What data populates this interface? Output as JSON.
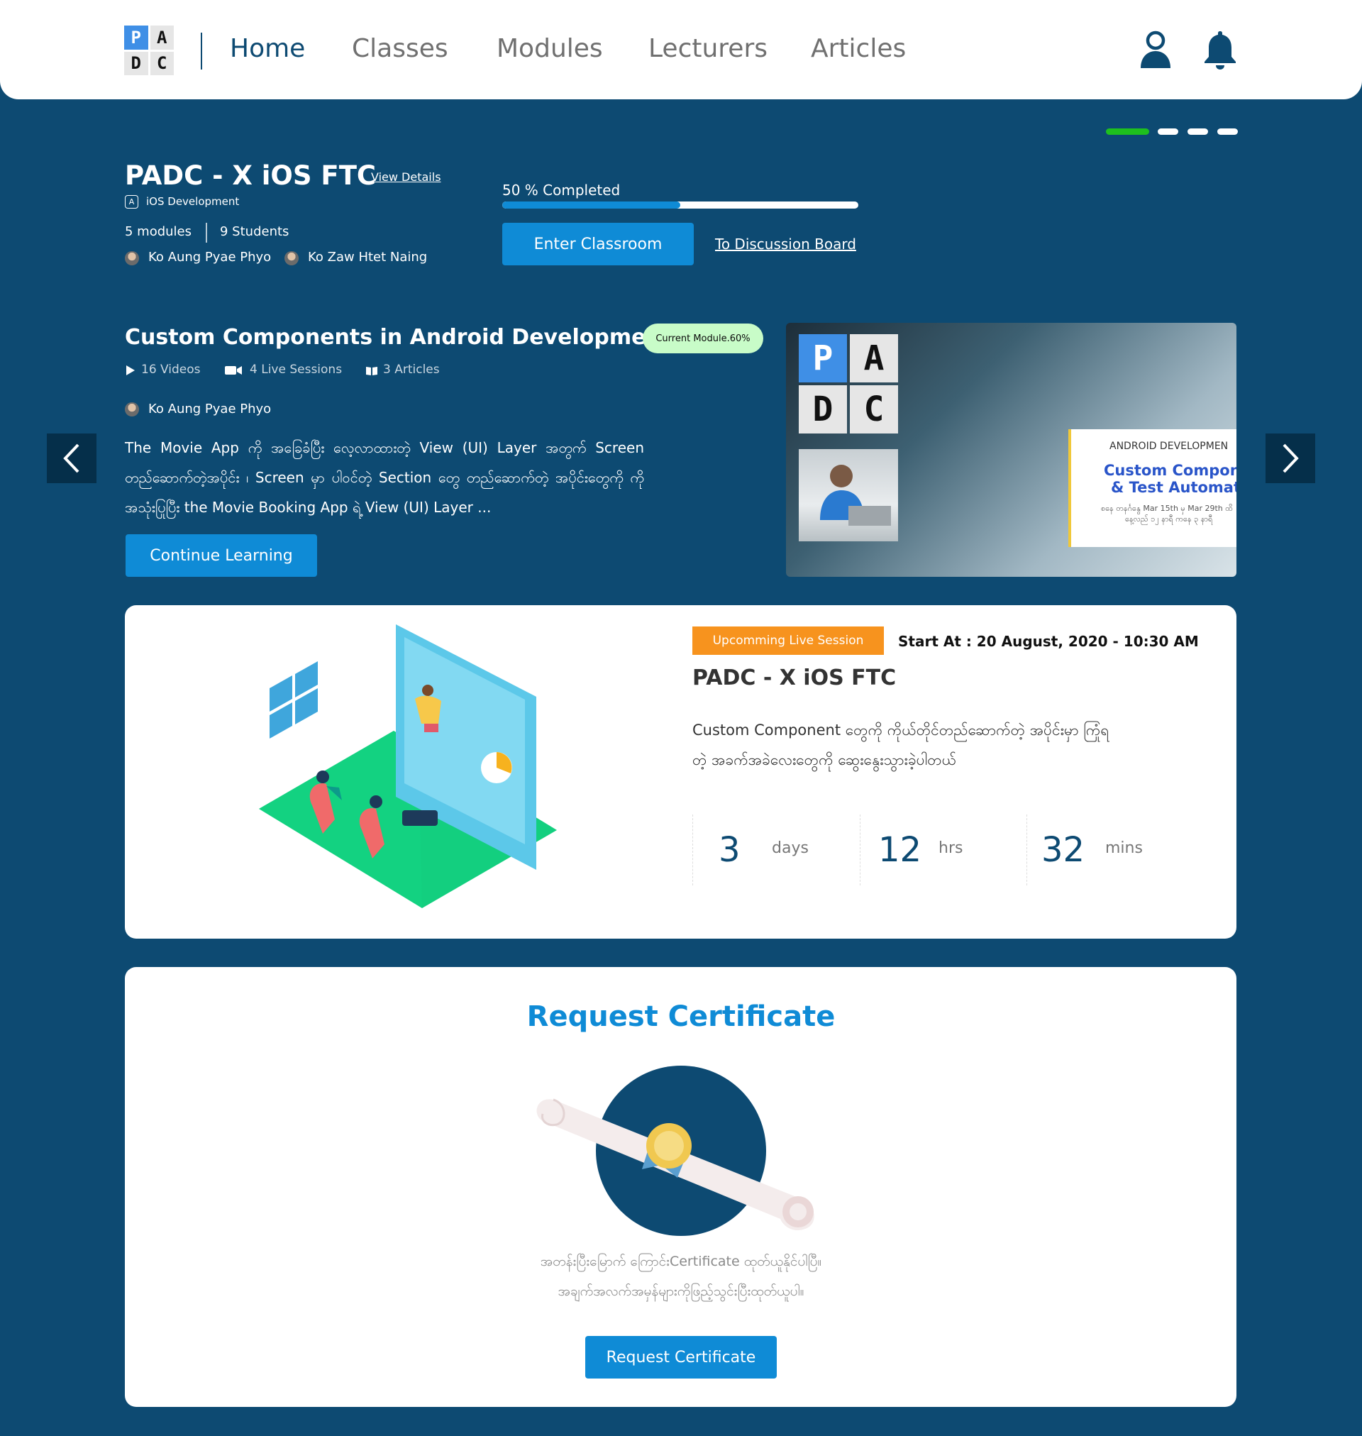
{
  "header": {
    "logo_letters": [
      "P",
      "A",
      "D",
      "C"
    ],
    "nav": [
      "Home",
      "Classes",
      "Modules",
      "Lecturers",
      "Articles"
    ],
    "active_nav": "Home",
    "icons": [
      "profile-icon",
      "bell-icon"
    ]
  },
  "carousel": {
    "slides": 4,
    "active_index": 0,
    "active_color": "#1ec01e"
  },
  "class_info": {
    "title": "PADC - X iOS FTC",
    "view_details": "View Details",
    "category": "iOS Development",
    "modules": "5 modules",
    "students": "9 Students",
    "lecturers": [
      "Ko Aung Pyae Phyo",
      "Ko Zaw Htet Naing"
    ],
    "progress_label": "50 % Completed",
    "progress": 0.5,
    "enter_button": "Enter Classroom",
    "discussion_link": "To Discussion Board"
  },
  "current_module": {
    "title": "Custom Components in Android Development",
    "badge": "Current Module.60%",
    "videos": "16 Videos",
    "live_sessions": "4 Live Sessions",
    "articles": "3 Articles",
    "lecturer": "Ko Aung Pyae Phyo",
    "description": "The Movie App ကို အခြေခံပြီး လေ့လာထားတဲ့ View (UI) Layer အတွက် Screen တည်ဆောက်တဲ့အပိုင်း ၊ Screen မှာ ပါဝင်တဲ့ Section တွေ တည်ဆောက်တဲ့ အပိုင်းတွေကို ကို အသုံးပြုပြီး the Movie Booking App ရဲ့ View (UI) Layer ...",
    "continue_button": "Continue Learning",
    "thumbnail": {
      "logo_letters": [
        "P",
        "A",
        "D",
        "C"
      ],
      "small": "ANDROID DEVELOPMEN",
      "line1": "Custom Componen",
      "line2": "& Test Automatio",
      "tiny1": "စနေ တနင်္ဂနွေ Mar 15th မှ Mar 29th ထိ",
      "tiny2": "နေ့လည် ၁၂ နာရီ ကနေ ၃ နာရီ"
    }
  },
  "live_session": {
    "badge": "Upcomming Live Session",
    "start_at": "Start At : 20 August, 2020 - 10:30 AM",
    "title": "PADC - X iOS FTC",
    "description": "Custom Component တွေကို ကိုယ်တိုင်တည်ဆောက်တဲ့ အပိုင်းမှာ ကြုံရတဲ့ အခက်အခဲလေးတွေကို ဆွေးနွေးသွားခဲ့ပါတယ်",
    "countdown": [
      {
        "value": "3",
        "unit": "days"
      },
      {
        "value": "12",
        "unit": "hrs"
      },
      {
        "value": "32",
        "unit": "mins"
      }
    ]
  },
  "certificate": {
    "title": "Request Certificate",
    "line1": "အတန်းပြီးမြောက် ကြောင်းCertificate ထုတ်ယူနိုင်ပါပြီ။",
    "line2": "အချက်အလက်အမှန်များကိုဖြည့်သွင်းပြီးထုတ်ယူပါ။",
    "button": "Request Certificate"
  },
  "colors": {
    "background": "#0d4a72",
    "primary": "#0f8bd6",
    "badge_orange": "#f7931e",
    "badge_green": "#c8fcc8"
  }
}
